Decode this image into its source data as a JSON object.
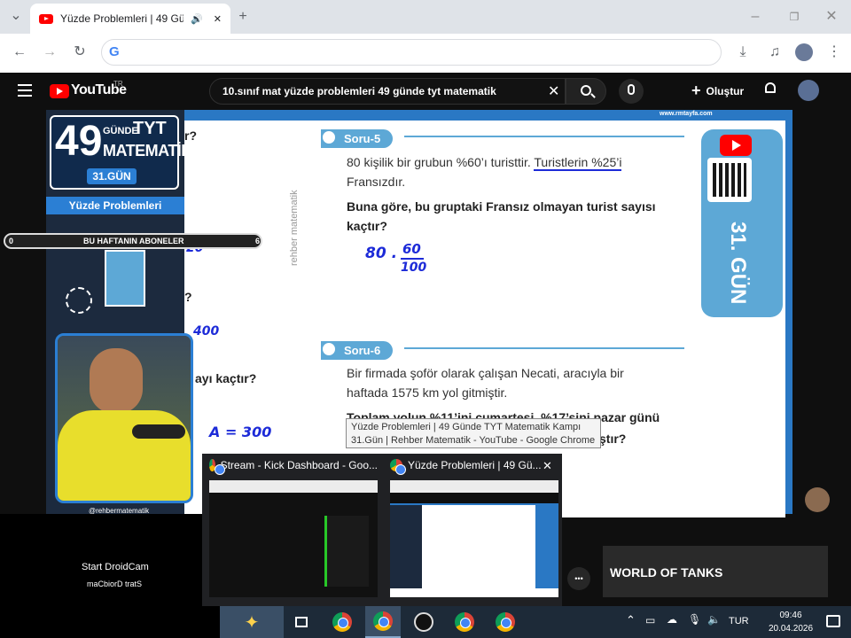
{
  "browser": {
    "tab_title": "Yüzde Problemleri | 49 Günde",
    "new_tab": "+",
    "minimize": "–",
    "maximize": "❐",
    "close": "✕",
    "back": "←",
    "forward": "→",
    "reload": "↻",
    "google_g": "G",
    "menu_dots": "⋮",
    "download": "⤓"
  },
  "youtube": {
    "logo": "YouTube",
    "logo_country": "TR",
    "search_value": "10.sınıf mat yüzde problemleri 49 günde tyt matematik",
    "create_label": "Oluştur",
    "clear": "✕"
  },
  "video": {
    "site": "www.rmtayfa.com",
    "logo_49": "49",
    "logo_gunde": "GÜNDE",
    "logo_tyt": "TYT",
    "logo_matematik": "MATEMATİK",
    "day_badge": "31.GÜN",
    "topic": "Yüzde Problemleri",
    "ticker_left": "0",
    "ticker_text": "BU HAFTANIN ABONELER",
    "ticker_right": "6",
    "side_watermark": "rehber matematik",
    "instagram": "@rehbermatematik",
    "side_day": "31. GÜN",
    "cut_text_1": "r?",
    "cut_text_2": "?",
    "cut_text_3": "ayı kaçtır?",
    "hand_left_1": "20",
    "hand_left_2": "400",
    "hand_left_3": "A = 300",
    "soru5": {
      "label": "Soru-5",
      "line1_a": "80 kişilik bir grubun %60’ı turisttir. ",
      "line1_b": "Turistlerin %25’i",
      "line2": "Fransızdır.",
      "bold1": "Buna göre, bu gruptaki Fransız olmayan turist sayısı",
      "bold2": "kaçtır?",
      "hand_80": "80 .",
      "hand_num": "60",
      "hand_den": "100"
    },
    "soru6": {
      "label": "Soru-6",
      "line1": "Bir firmada şoför olarak çalışan Necati, aracıyla bir",
      "line2": "haftada 1575 km yol gitmiştir.",
      "bold1": "Toplam yolun %11’ini cumartesi, %17’sini pazar günü",
      "bold2": "ştır?"
    }
  },
  "tooltip": {
    "line1": "Yüzde Problemleri | 49 Günde TYT Matematik Kampı",
    "line2": "31.Gün | Rehber Matematik - YouTube - Google Chrome"
  },
  "thumbnails": [
    {
      "title": "Stream - Kick Dashboard - Goo..."
    },
    {
      "title": "Yüzde Problemleri | 49 Gü...",
      "close": "✕"
    }
  ],
  "droidcam": {
    "line1": "Start DroidCam",
    "line2": "maCbiorD tratS"
  },
  "ad": {
    "brand": "WORLD OF TANKS"
  },
  "more_btn": "•••",
  "taskbar": {
    "language": "TUR",
    "time": "09:46",
    "date": "20.04.2026"
  }
}
